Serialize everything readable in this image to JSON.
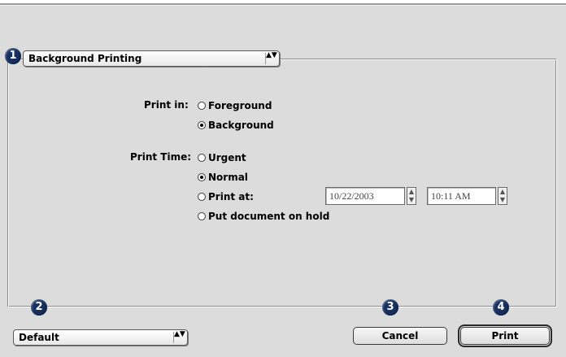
{
  "panel_popup": {
    "label": "Background Printing",
    "arrows": "▲▼"
  },
  "print_in": {
    "label": "Print in:",
    "options": [
      {
        "label": "Foreground",
        "checked": false
      },
      {
        "label": "Background",
        "checked": true
      }
    ]
  },
  "print_time": {
    "label": "Print Time:",
    "options": [
      {
        "label": "Urgent",
        "checked": false
      },
      {
        "label": "Normal",
        "checked": true
      },
      {
        "label": "Print at:",
        "checked": false
      },
      {
        "label": "Put document on hold",
        "checked": false
      }
    ],
    "date_value": "10/22/2003",
    "time_value": "10:11 AM"
  },
  "preset_popup": {
    "label": "Default",
    "arrows": "▲▼"
  },
  "buttons": {
    "cancel": "Cancel",
    "print": "Print"
  },
  "callouts": [
    "1",
    "2",
    "3",
    "4"
  ],
  "colors": {
    "callout": "#17305f",
    "dialog_bg": "#dcdcdc"
  },
  "icons": {
    "stepper_up": "▲",
    "stepper_down": "▼"
  }
}
